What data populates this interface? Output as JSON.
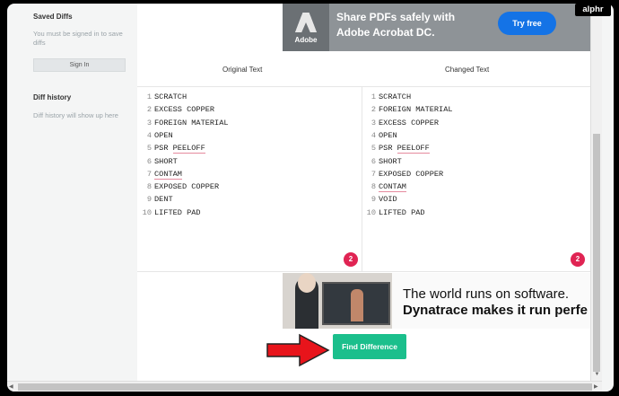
{
  "sidebar": {
    "saved_title": "Saved Diffs",
    "saved_note": "You must be signed in to save diffs",
    "sign_in_label": "Sign In",
    "history_title": "Diff history",
    "history_note": "Diff history will show up here"
  },
  "top_ad": {
    "brand": "Adobe",
    "headline_1": "Share PDFs safely with",
    "headline_2": "Adobe Acrobat DC.",
    "cta": "Try free"
  },
  "columns": {
    "original_header": "Original Text",
    "changed_header": "Changed Text"
  },
  "original_lines": [
    {
      "n": "1",
      "text": "SCRATCH"
    },
    {
      "n": "2",
      "text": "EXCESS COPPER"
    },
    {
      "n": "3",
      "text": "FOREIGN MATERIAL"
    },
    {
      "n": "4",
      "text": "OPEN"
    },
    {
      "n": "5",
      "pre": "PSR ",
      "err": "PEELOFF"
    },
    {
      "n": "6",
      "text": "SHORT"
    },
    {
      "n": "7",
      "err": "CONTAM"
    },
    {
      "n": "8",
      "text": "EXPOSED COPPER"
    },
    {
      "n": "9",
      "text": "DENT"
    },
    {
      "n": "10",
      "text": "LIFTED PAD"
    }
  ],
  "changed_lines": [
    {
      "n": "1",
      "text": "SCRATCH"
    },
    {
      "n": "2",
      "text": "FOREIGN MATERIAL"
    },
    {
      "n": "3",
      "text": "EXCESS COPPER"
    },
    {
      "n": "4",
      "text": "OPEN"
    },
    {
      "n": "5",
      "pre": "PSR ",
      "err": "PEELOFF"
    },
    {
      "n": "6",
      "text": "SHORT"
    },
    {
      "n": "7",
      "text": "EXPOSED COPPER"
    },
    {
      "n": "8",
      "err": "CONTAM"
    },
    {
      "n": "9",
      "text": "VOID"
    },
    {
      "n": "10",
      "text": "LIFTED PAD"
    }
  ],
  "original_error_count": "2",
  "changed_error_count": "2",
  "bottom_ad": {
    "line_1": "The world runs on software.",
    "line_2": "Dynatrace makes it run perfe"
  },
  "find_button_label": "Find Difference",
  "watermark": "alphr",
  "colors": {
    "find_button": "#1bbf8c",
    "badge": "#e02453",
    "adobe_cta": "#1473e6",
    "arrow": "#e8141b"
  }
}
